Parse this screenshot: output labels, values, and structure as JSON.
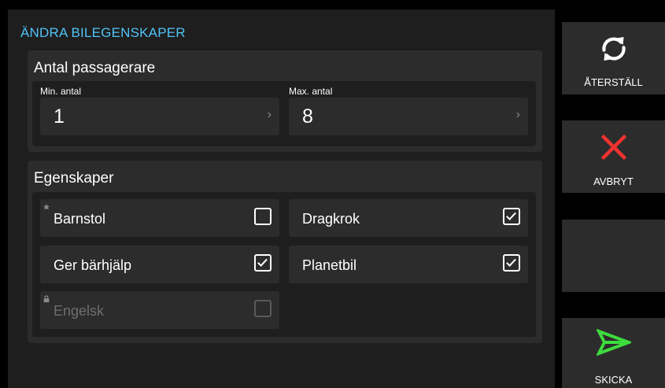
{
  "page": {
    "title": "ÄNDRA BILEGENSKAPER"
  },
  "passengers": {
    "heading": "Antal passagerare",
    "min": {
      "label": "Min. antal",
      "value": "1"
    },
    "max": {
      "label": "Max. antal",
      "value": "8"
    }
  },
  "features": {
    "heading": "Egenskaper",
    "items": [
      {
        "label": "Barnstol",
        "checked": false,
        "marker": "star-icon",
        "disabled": false
      },
      {
        "label": "Dragkrok",
        "checked": true,
        "disabled": false
      },
      {
        "label": "Ger bärhjälp",
        "checked": true,
        "disabled": false
      },
      {
        "label": "Planetbil",
        "checked": true,
        "disabled": false
      },
      {
        "label": "Engelsk",
        "checked": false,
        "marker": "lock-icon",
        "disabled": true
      }
    ]
  },
  "actions": {
    "reset": {
      "label": "ÅTERSTÄLL",
      "icon": "refresh-icon"
    },
    "cancel": {
      "label": "AVBRYT",
      "icon": "close-icon"
    },
    "send": {
      "label": "SKICKA",
      "icon": "send-icon"
    }
  },
  "colors": {
    "accent": "#4fc3f7",
    "cancel": "#f0332f",
    "send": "#3ddc3d"
  }
}
